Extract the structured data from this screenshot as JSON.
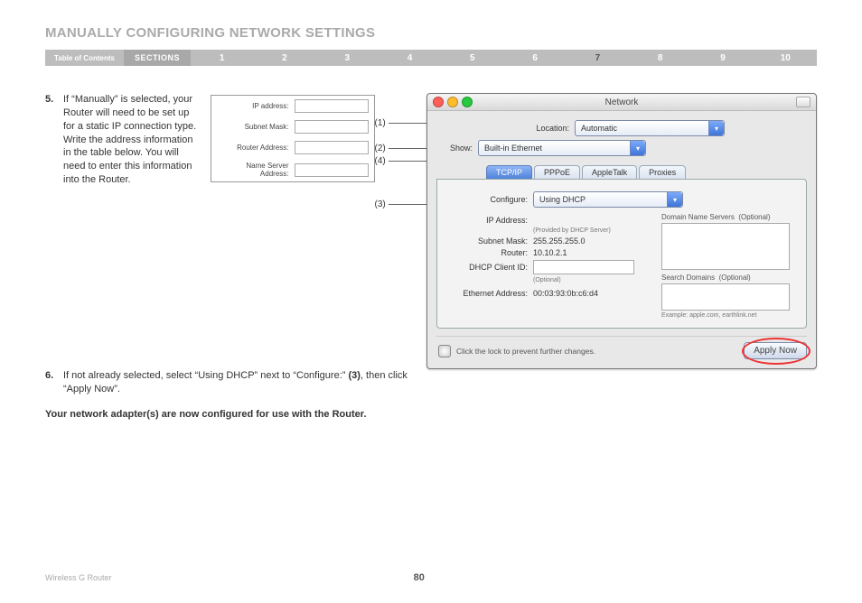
{
  "header": {
    "title": "MANUALLY CONFIGURING NETWORK SETTINGS"
  },
  "nav": {
    "toc": "Table of Contents",
    "sections_label": "SECTIONS",
    "items": [
      "1",
      "2",
      "3",
      "4",
      "5",
      "6",
      "7",
      "8",
      "9",
      "10"
    ],
    "active": "7"
  },
  "steps": {
    "s5": {
      "num": "5.",
      "text": "If “Manually” is selected, your Router will need to be set up for a static IP connection type. Write the address information in the table below. You will need to enter this information into the Router."
    },
    "s6": {
      "num": "6.",
      "text_a": "If not already selected, select “Using DHCP” next to “Configure:” ",
      "text_b": "(3)",
      "text_c": ", then click “Apply Now”."
    },
    "conclusion": "Your network adapter(s) are now configured for use with the Router."
  },
  "cfg_table": {
    "ip": "IP address:",
    "subnet": "Subnet Mask:",
    "router": "Router Address:",
    "ns": "Name Server Address:"
  },
  "callouts": {
    "c1": "(1)",
    "c2": "(2)",
    "c3": "(3)",
    "c4": "(4)"
  },
  "mac": {
    "title": "Network",
    "location_label": "Location:",
    "location_value": "Automatic",
    "show_label": "Show:",
    "show_value": "Built-in Ethernet",
    "tabs": {
      "tcpip": "TCP/IP",
      "pppoe": "PPPoE",
      "appletalk": "AppleTalk",
      "proxies": "Proxies"
    },
    "configure_label": "Configure:",
    "configure_value": "Using DHCP",
    "ip_label": "IP Address:",
    "ip_hint": "(Provided by DHCP Server)",
    "subnet_label": "Subnet Mask:",
    "subnet_value": "255.255.255.0",
    "router_label": "Router:",
    "router_value": "10.10.2.1",
    "dhcp_label": "DHCP Client ID:",
    "dhcp_hint": "(Optional)",
    "eth_label": "Ethernet Address:",
    "eth_value": "00:03:93:0b:c6:d4",
    "dns_head": "Domain Name Servers",
    "dns_opt": "(Optional)",
    "sd_head": "Search Domains",
    "sd_opt": "(Optional)",
    "sd_example": "Example: apple.com, earthlink.net",
    "lock_text": "Click the lock to prevent further changes.",
    "apply": "Apply Now"
  },
  "footer": {
    "product": "Wireless G Router",
    "page": "80"
  }
}
